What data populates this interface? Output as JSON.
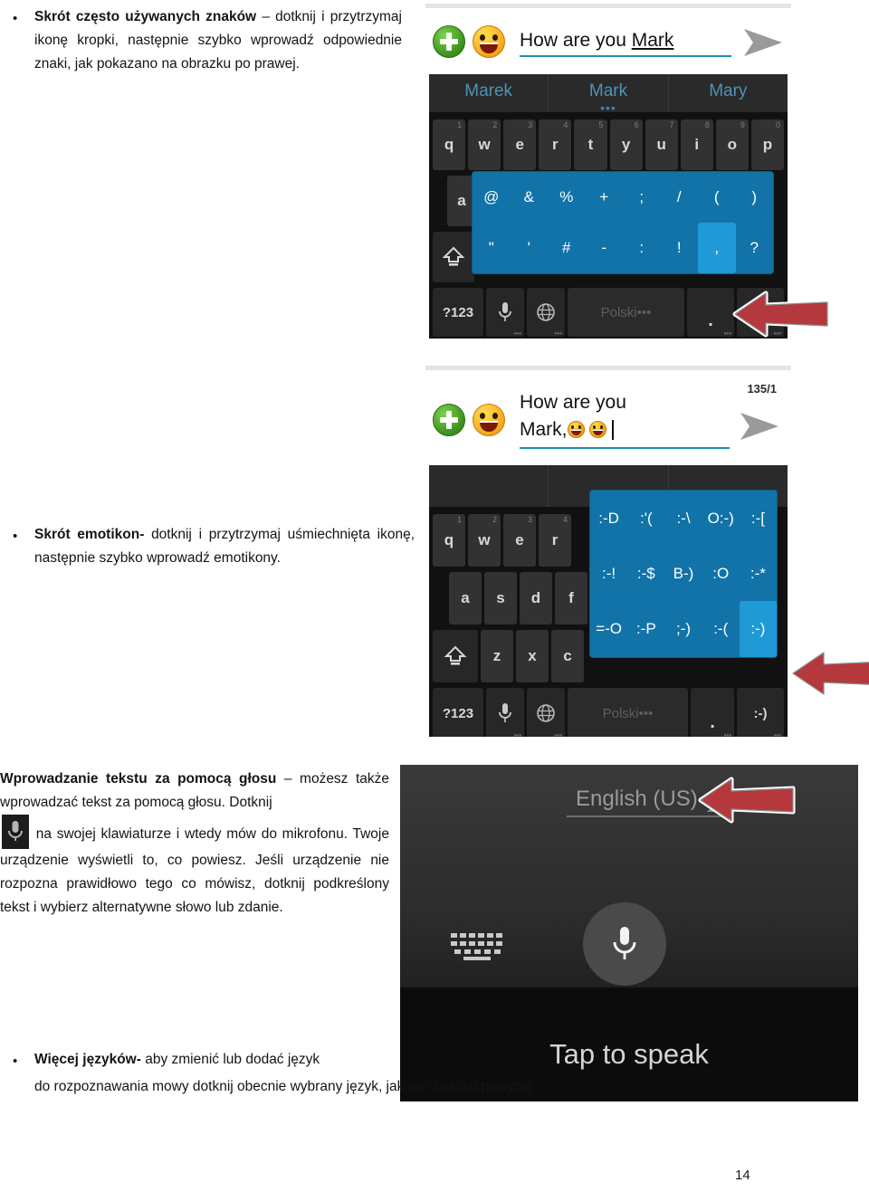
{
  "document": {
    "page_number": "14",
    "language": "pl"
  },
  "bullets": {
    "shortcut_symbols": {
      "marker": "•",
      "bold_lead": "Skrót często używanych znaków",
      "rest": " – dotknij i przytrzymaj ikonę kropki, następnie szybko wprowadź odpowiednie znaki, jak pokazano na obrazku po prawej."
    },
    "shortcut_emoticons": {
      "marker": "•",
      "bold_lead": "Skrót emotikon-",
      "rest": " dotknij i przytrzymaj uśmiechnięta ikonę, następnie szybko wprowadź emotikony."
    },
    "voice_input": {
      "bold_lead": "Wprowadzanie tekstu za pomocą głosu",
      "part1": " – możesz także wprowadzać tekst za pomocą głosu. Dotknij",
      "part2": " na swojej klawiaturze i wtedy mów do mikrofonu. Twoje urządzenie wyświetli to, co powiesz. Jeśli urządzenie nie rozpozna prawidłowo tego co mówisz, dotknij podkreślony tekst i wybierz alternatywne słowo lub zdanie."
    },
    "more_languages": {
      "marker": "•",
      "bold_lead": "Więcej języków-",
      "rest": " aby zmienić lub dodać język",
      "line2": "do rozpoznawania mowy dotknij obecnie wybrany język, jak na obrazku powyżej."
    }
  },
  "screenshot_symbols": {
    "compose": {
      "message_plain": "How are you ",
      "message_underlined": "Mark",
      "plus_icon": "add-attachment-icon",
      "smiley_icon": "insert-emoticon-icon",
      "send_icon": "send-arrow-icon"
    },
    "suggestions": [
      "Marek",
      "Mark",
      "Mary"
    ],
    "suggestion_more_dots": "•••",
    "rows": {
      "top_letters": [
        "q",
        "w",
        "e",
        "r",
        "t",
        "y",
        "u",
        "i",
        "o",
        "p"
      ],
      "top_numbers": [
        "1",
        "2",
        "3",
        "4",
        "5",
        "6",
        "7",
        "8",
        "9",
        "0"
      ],
      "second_first_key": "a",
      "shift_key": "shift-icon",
      "symbol_key": "?123",
      "mic_key": "mic-icon",
      "globe_key": "globe-icon",
      "space_key": "Polski",
      "period_key": ".",
      "last_key": ""
    },
    "popup_symbols": [
      [
        "@",
        "&",
        "%",
        "+",
        ";",
        "/",
        "(",
        ")"
      ],
      [
        "\"",
        "'",
        "#",
        "-",
        ":",
        "!",
        ",",
        "?"
      ]
    ],
    "popup_selected": ","
  },
  "screenshot_emoticons": {
    "compose": {
      "message_line1": "How are you",
      "message_line2": "Mark,",
      "char_count": "135/1",
      "plus_icon": "add-attachment-icon",
      "smiley_icon": "insert-emoticon-icon",
      "send_icon": "send-arrow-icon",
      "inline_emoticons": 2
    },
    "rows": {
      "top_letters": [
        "q",
        "w",
        "e",
        "r"
      ],
      "top_numbers": [
        "1",
        "2",
        "3",
        "4"
      ],
      "second_letters": [
        "a",
        "s",
        "d",
        "f"
      ],
      "third_letters": [
        "z",
        "x",
        "c"
      ],
      "shift_key": "shift-icon",
      "symbol_key": "?123",
      "mic_key": "mic-icon",
      "globe_key": "globe-icon",
      "space_key": "Polski",
      "period_key": ".",
      "smiley_key": ":-)"
    },
    "popup_emoticons": [
      [
        ":-D",
        ":'(",
        ":-\\",
        "O:-)",
        ":-["
      ],
      [
        ":-!",
        ":-$",
        "B-)",
        ":O",
        ":-*"
      ],
      [
        "=-O",
        ":-P",
        ";-)",
        ":-(",
        ":-)"
      ]
    ],
    "popup_selected": ":-)"
  },
  "screenshot_voice": {
    "language_label": "English (US)",
    "language_dropdown_icon": "dropdown-triangle-icon",
    "mic_button_icon": "mic-icon",
    "keyboard_switch_icon": "keyboard-icon",
    "prompt": "Tap to speak"
  },
  "annotations": {
    "pointer_icon": "red-left-arrow-pointer",
    "pointer_color": "#b4383c"
  }
}
